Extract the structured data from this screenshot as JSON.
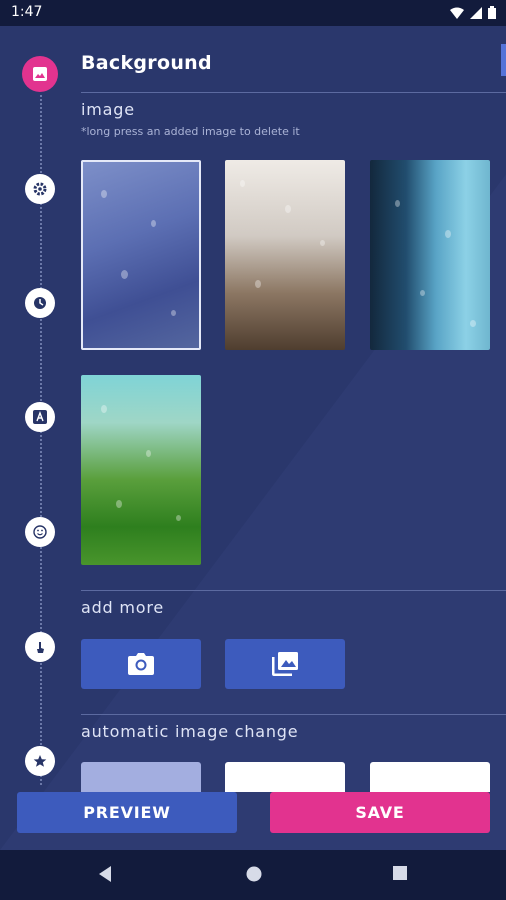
{
  "status_bar": {
    "time": "1:47",
    "icons": [
      "wifi-icon",
      "signal-icon",
      "battery-icon"
    ]
  },
  "timeline": {
    "steps": [
      {
        "icon": "image-icon",
        "active": true
      },
      {
        "icon": "gear-icon",
        "active": false
      },
      {
        "icon": "clock-icon",
        "active": false
      },
      {
        "icon": "font-icon",
        "active": false
      },
      {
        "icon": "smiley-icon",
        "active": false
      },
      {
        "icon": "touch-icon",
        "active": false
      },
      {
        "icon": "star-icon",
        "active": false
      }
    ]
  },
  "section": {
    "title": "Background"
  },
  "image_section": {
    "label": "image",
    "hint": "*long press an added image to delete it",
    "thumbnails": [
      {
        "name": "rain-window-blue",
        "selected": true
      },
      {
        "name": "rain-window-beige",
        "selected": false
      },
      {
        "name": "rain-window-teal",
        "selected": false
      },
      {
        "name": "rain-window-green",
        "selected": false
      }
    ]
  },
  "add_more": {
    "label": "add more",
    "buttons": [
      {
        "icon": "camera-icon"
      },
      {
        "icon": "gallery-icon"
      }
    ]
  },
  "auto_change": {
    "label": "automatic image change"
  },
  "actions": {
    "preview": "PREVIEW",
    "save": "SAVE"
  },
  "colors": {
    "accent_pink": "#e2338f",
    "button_blue": "#3d5bbd",
    "background": "#273466"
  }
}
